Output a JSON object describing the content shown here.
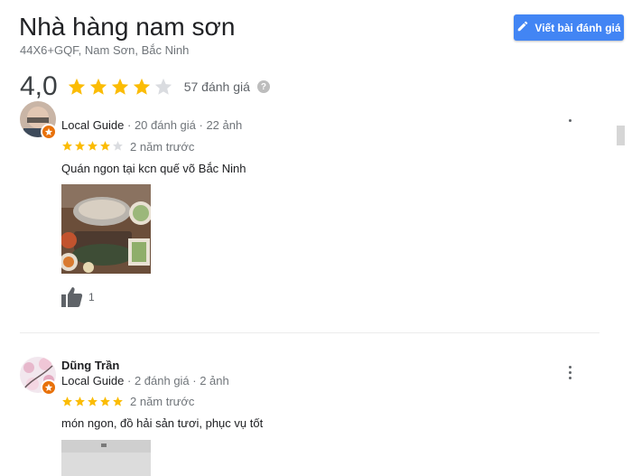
{
  "place": {
    "name": "Nhà hàng nam sơn",
    "address": "44X6+GQF, Nam Sơn, Bắc Ninh",
    "rating": "4,0",
    "stars": 4,
    "review_count": "57 đánh giá",
    "help_glyph": "?"
  },
  "actions": {
    "write_review": "Viết bài đánh giá",
    "write_icon": "pencil-icon"
  },
  "colors": {
    "accent": "#4285f4",
    "star": "#fbbc04",
    "star_empty": "#dadce0",
    "guide_badge": "#e8710a"
  },
  "reviews": [
    {
      "name": "",
      "meta": "Local Guide",
      "meta_sub": " · 20 đánh giá · 22 ảnh",
      "stars": 4,
      "time": "2 năm trước",
      "text": "Quán ngon tại kcn quế võ Bắc Ninh",
      "likes": "1"
    },
    {
      "name": "Dũng Trần",
      "meta": "Local Guide",
      "meta_sub": " · 2 đánh giá · 2 ảnh",
      "stars": 5,
      "time": "2 năm trước",
      "text": "món ngon, đồ hải sản tươi, phục vụ tốt"
    }
  ]
}
